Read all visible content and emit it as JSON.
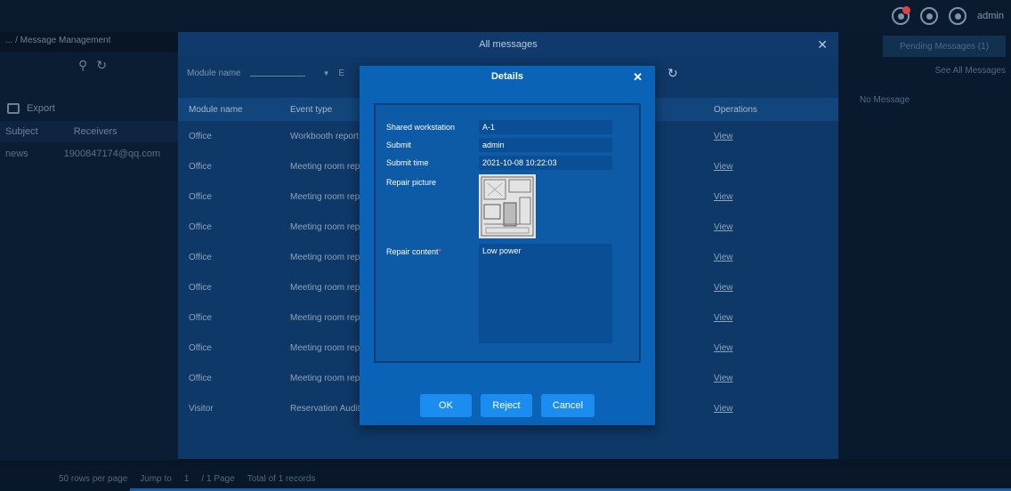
{
  "topbar": {
    "username": "admin"
  },
  "background": {
    "breadcrumb": "... / Message Management",
    "export_label": "Export",
    "columns": [
      "Subject",
      "Receivers"
    ],
    "row": {
      "subject": "news",
      "receiver": "1900847174@qq.com"
    },
    "pending_button": "Pending Messages (1)",
    "see_all": "See All Messages",
    "no_message": "No Message",
    "footer": {
      "rows_per_page": "50 rows per page",
      "jump_to": "Jump to",
      "page_value": "1",
      "page_label": "/ 1 Page",
      "total": "Total of 1 records"
    }
  },
  "all_messages": {
    "title": "All messages",
    "filter_label": "Module name",
    "filter_value": "-------",
    "filter_next_initial": "E",
    "columns": {
      "module": "Module name",
      "event": "Event type",
      "operations": "Operations"
    },
    "rows": [
      {
        "module": "Office",
        "event": "Workbooth report a",
        "op": "View"
      },
      {
        "module": "Office",
        "event": "Meeting room repa",
        "op": "View"
      },
      {
        "module": "Office",
        "event": "Meeting room repo",
        "op": "View"
      },
      {
        "module": "Office",
        "event": "Meeting room repa",
        "op": "View"
      },
      {
        "module": "Office",
        "event": "Meeting room repo",
        "op": "View"
      },
      {
        "module": "Office",
        "event": "Meeting room repa",
        "op": "View"
      },
      {
        "module": "Office",
        "event": "Meeting room repo",
        "op": "View"
      },
      {
        "module": "Office",
        "event": "Meeting room repa",
        "op": "View"
      },
      {
        "module": "Office",
        "event": "Meeting room repo",
        "op": "View"
      },
      {
        "module": "Visitor",
        "event": "Reservation Audit",
        "op": "View"
      }
    ]
  },
  "details": {
    "title": "Details",
    "shared_workstation_label": "Shared workstation",
    "shared_workstation_value": "A-1",
    "submit_label": "Submit",
    "submit_value": "admin",
    "submit_time_label": "Submit time",
    "submit_time_value": "2021-10-08 10:22:03",
    "repair_picture_label": "Repair picture",
    "repair_content_label": "Repair content",
    "repair_content_required": "*",
    "repair_content_value": "Low power",
    "ok": "OK",
    "reject": "Reject",
    "cancel": "Cancel"
  }
}
